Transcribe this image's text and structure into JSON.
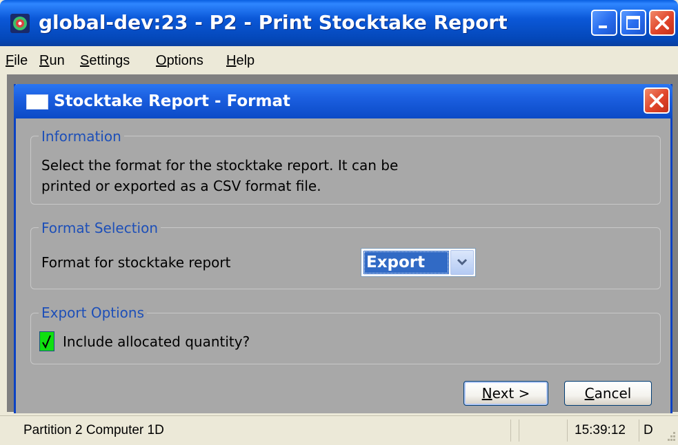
{
  "window": {
    "title": "global-dev:23 - P2 - Print Stocktake Report"
  },
  "menu": {
    "items": [
      {
        "mnemonic": "F",
        "rest": "ile"
      },
      {
        "mnemonic": "R",
        "rest": "un"
      },
      {
        "mnemonic": "S",
        "rest": "ettings"
      },
      {
        "mnemonic": "O",
        "rest": "ptions"
      },
      {
        "mnemonic": "H",
        "rest": "elp"
      }
    ]
  },
  "dialog": {
    "title": "Stocktake Report - Format",
    "information": {
      "label": "Information",
      "line1": "Select the format for the stocktake report. It can be",
      "line2": "printed or exported as a CSV format file."
    },
    "format_selection": {
      "label": "Format Selection",
      "field_label": "Format for stocktake report",
      "selected_value": "Export"
    },
    "export_options": {
      "label": "Export Options",
      "checkbox_label": "Include allocated quantity?",
      "checked": true
    },
    "buttons": {
      "next_mnemonic": "N",
      "next_rest": "ext >",
      "cancel_mnemonic": "C",
      "cancel_rest": "ancel"
    }
  },
  "statusbar": {
    "left": "Partition 2 Computer 1D",
    "time": "15:39:12",
    "mode": "D"
  },
  "colors": {
    "titlebar": "#0b58d8",
    "dialog_body": "#a8a8a8",
    "group_label": "#1d4fb8",
    "selection": "#316ac5",
    "checkbox": "#10e010"
  }
}
